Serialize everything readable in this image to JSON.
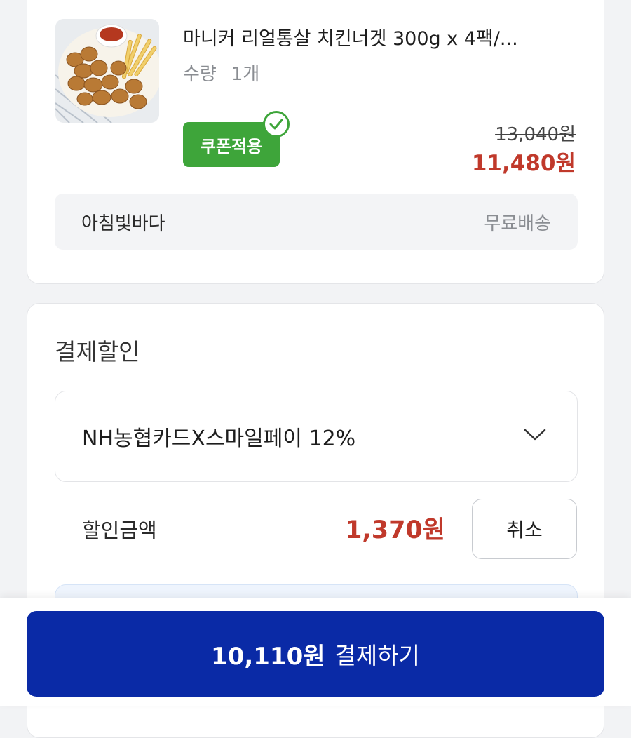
{
  "product": {
    "name": "마니커 리얼통살 치킨너겟 300g x 4팩/...",
    "quantity_label": "수량",
    "quantity_value": "1개",
    "coupon_badge": "쿠폰적용",
    "original_price": "13,040원",
    "final_price": "11,480원",
    "seller": "아침빛바다",
    "shipping": "무료배송",
    "image_icon": "chicken-nugget-plate-image"
  },
  "payment_discount": {
    "title": "결제할인",
    "selected_card": "NH농협카드X스마일페이 12%",
    "discount_label": "할인금액",
    "discount_amount": "1,370원",
    "cancel_label": "취소"
  },
  "checkout": {
    "amount": "10,110원",
    "label": "결제하기"
  },
  "colors": {
    "accent_red": "#c0392b",
    "coupon_green": "#3ea53a",
    "pay_button_blue": "#0a2aa6"
  }
}
